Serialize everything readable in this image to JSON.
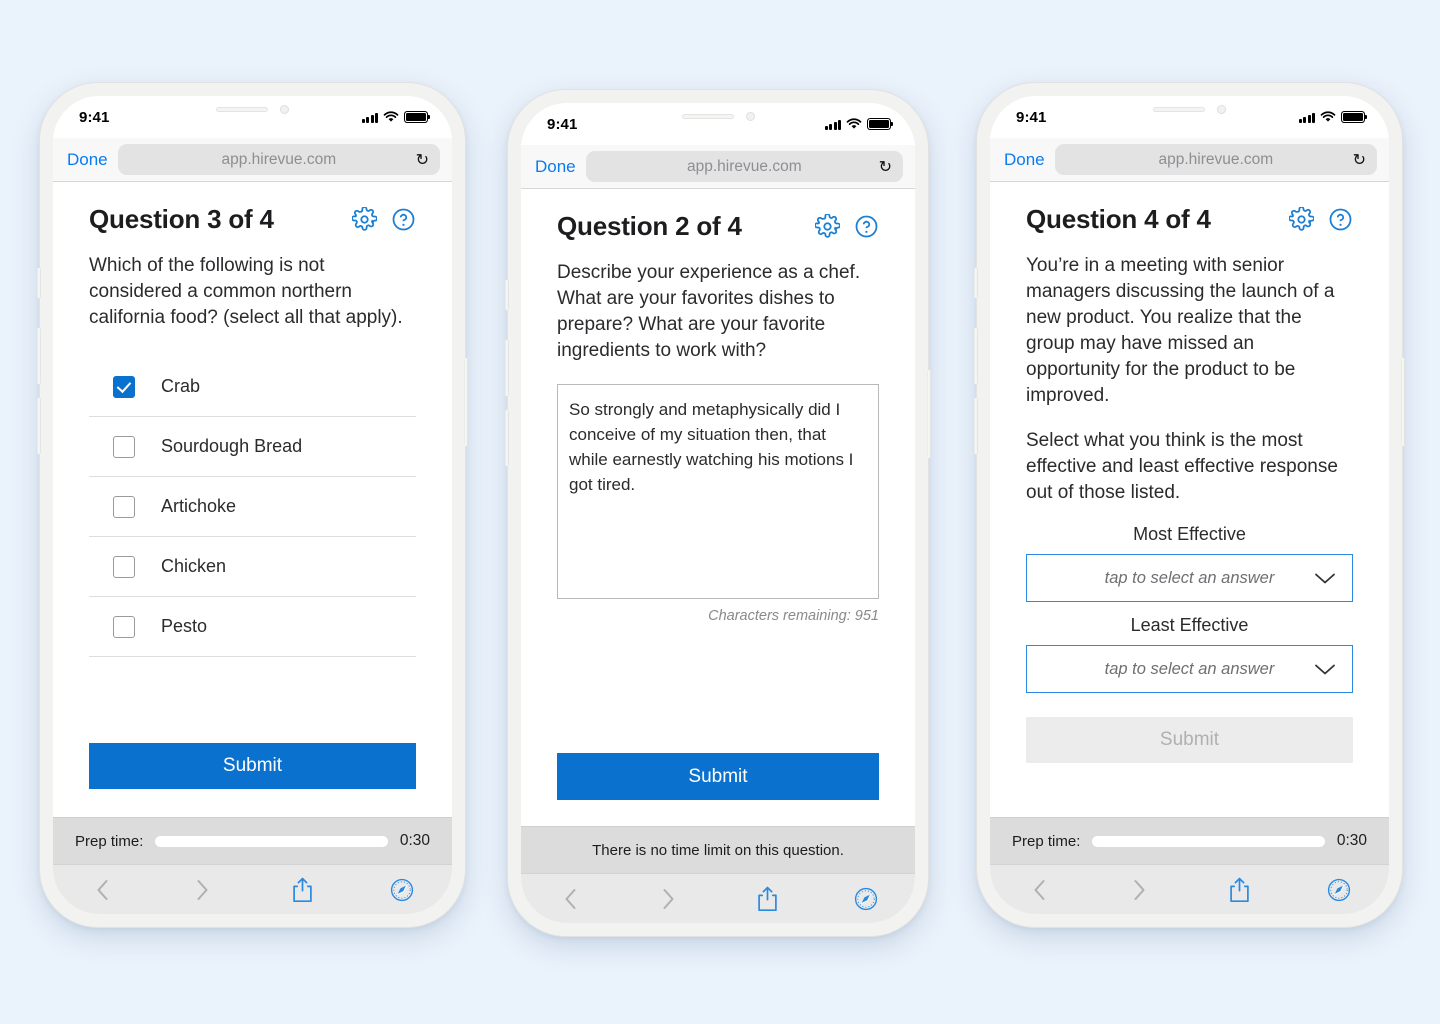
{
  "background_color": "#eaf2fb",
  "accent_blue": "#0a72ce",
  "link_blue": "#0a7bf0",
  "browser": {
    "done_label": "Done",
    "url": "app.hirevue.com",
    "reload_icon": "reload-icon",
    "back_icon": "back-chevron-icon",
    "forward_icon": "forward-chevron-icon",
    "share_icon": "share-icon",
    "safari_icon": "safari-compass-icon"
  },
  "status_bar": {
    "time": "9:41",
    "cellular_icon": "cellular-signal-icon",
    "wifi_icon": "wifi-icon",
    "battery_icon": "battery-full-icon"
  },
  "header_icons": {
    "settings": "gear-icon",
    "help": "help-circle-icon"
  },
  "phones": [
    {
      "id": "phone-question-3",
      "title": "Question 3 of 4",
      "question": "Which of the following is not considered a common northern california food? (select all that apply).",
      "type": "multiple-choice",
      "options": [
        {
          "label": "Crab",
          "checked": true
        },
        {
          "label": "Sourdough Bread",
          "checked": false
        },
        {
          "label": "Artichoke",
          "checked": false
        },
        {
          "label": "Chicken",
          "checked": false
        },
        {
          "label": "Pesto",
          "checked": false
        }
      ],
      "submit_label": "Submit",
      "submit_disabled": false,
      "footer": {
        "kind": "prep",
        "prep_label": "Prep time:",
        "prep_time": "0:30",
        "prep_progress_percent": 100
      }
    },
    {
      "id": "phone-question-2",
      "title": "Question 2 of 4",
      "question": "Describe your experience as a chef. What are your favorites dishes to prepare? What are your favorite ingredients to work with?",
      "type": "open-text",
      "answer_text": "So strongly and metaphysically did I conceive of my situation then, that while earnestly watching his motions I got tired.",
      "characters_remaining_label": "Characters remaining:",
      "characters_remaining_value": "951",
      "submit_label": "Submit",
      "submit_disabled": false,
      "footer": {
        "kind": "notice",
        "notice": "There is no time limit on this question."
      }
    },
    {
      "id": "phone-question-4",
      "title": "Question 4 of 4",
      "question_p1": "You’re in a meeting with senior managers discussing the launch of a new product. You realize that the group may have missed an opportunity for the product to be improved.",
      "question_p2": "Select what you think is the most effective and least effective response out of those listed.",
      "type": "most-least-effective",
      "most_effective_label": "Most Effective",
      "most_effective_value": "tap to select an answer",
      "least_effective_label": "Least Effective",
      "least_effective_value": "tap to select an answer",
      "submit_label": "Submit",
      "submit_disabled": true,
      "footer": {
        "kind": "prep",
        "prep_label": "Prep time:",
        "prep_time": "0:30",
        "prep_progress_percent": 100
      }
    }
  ]
}
